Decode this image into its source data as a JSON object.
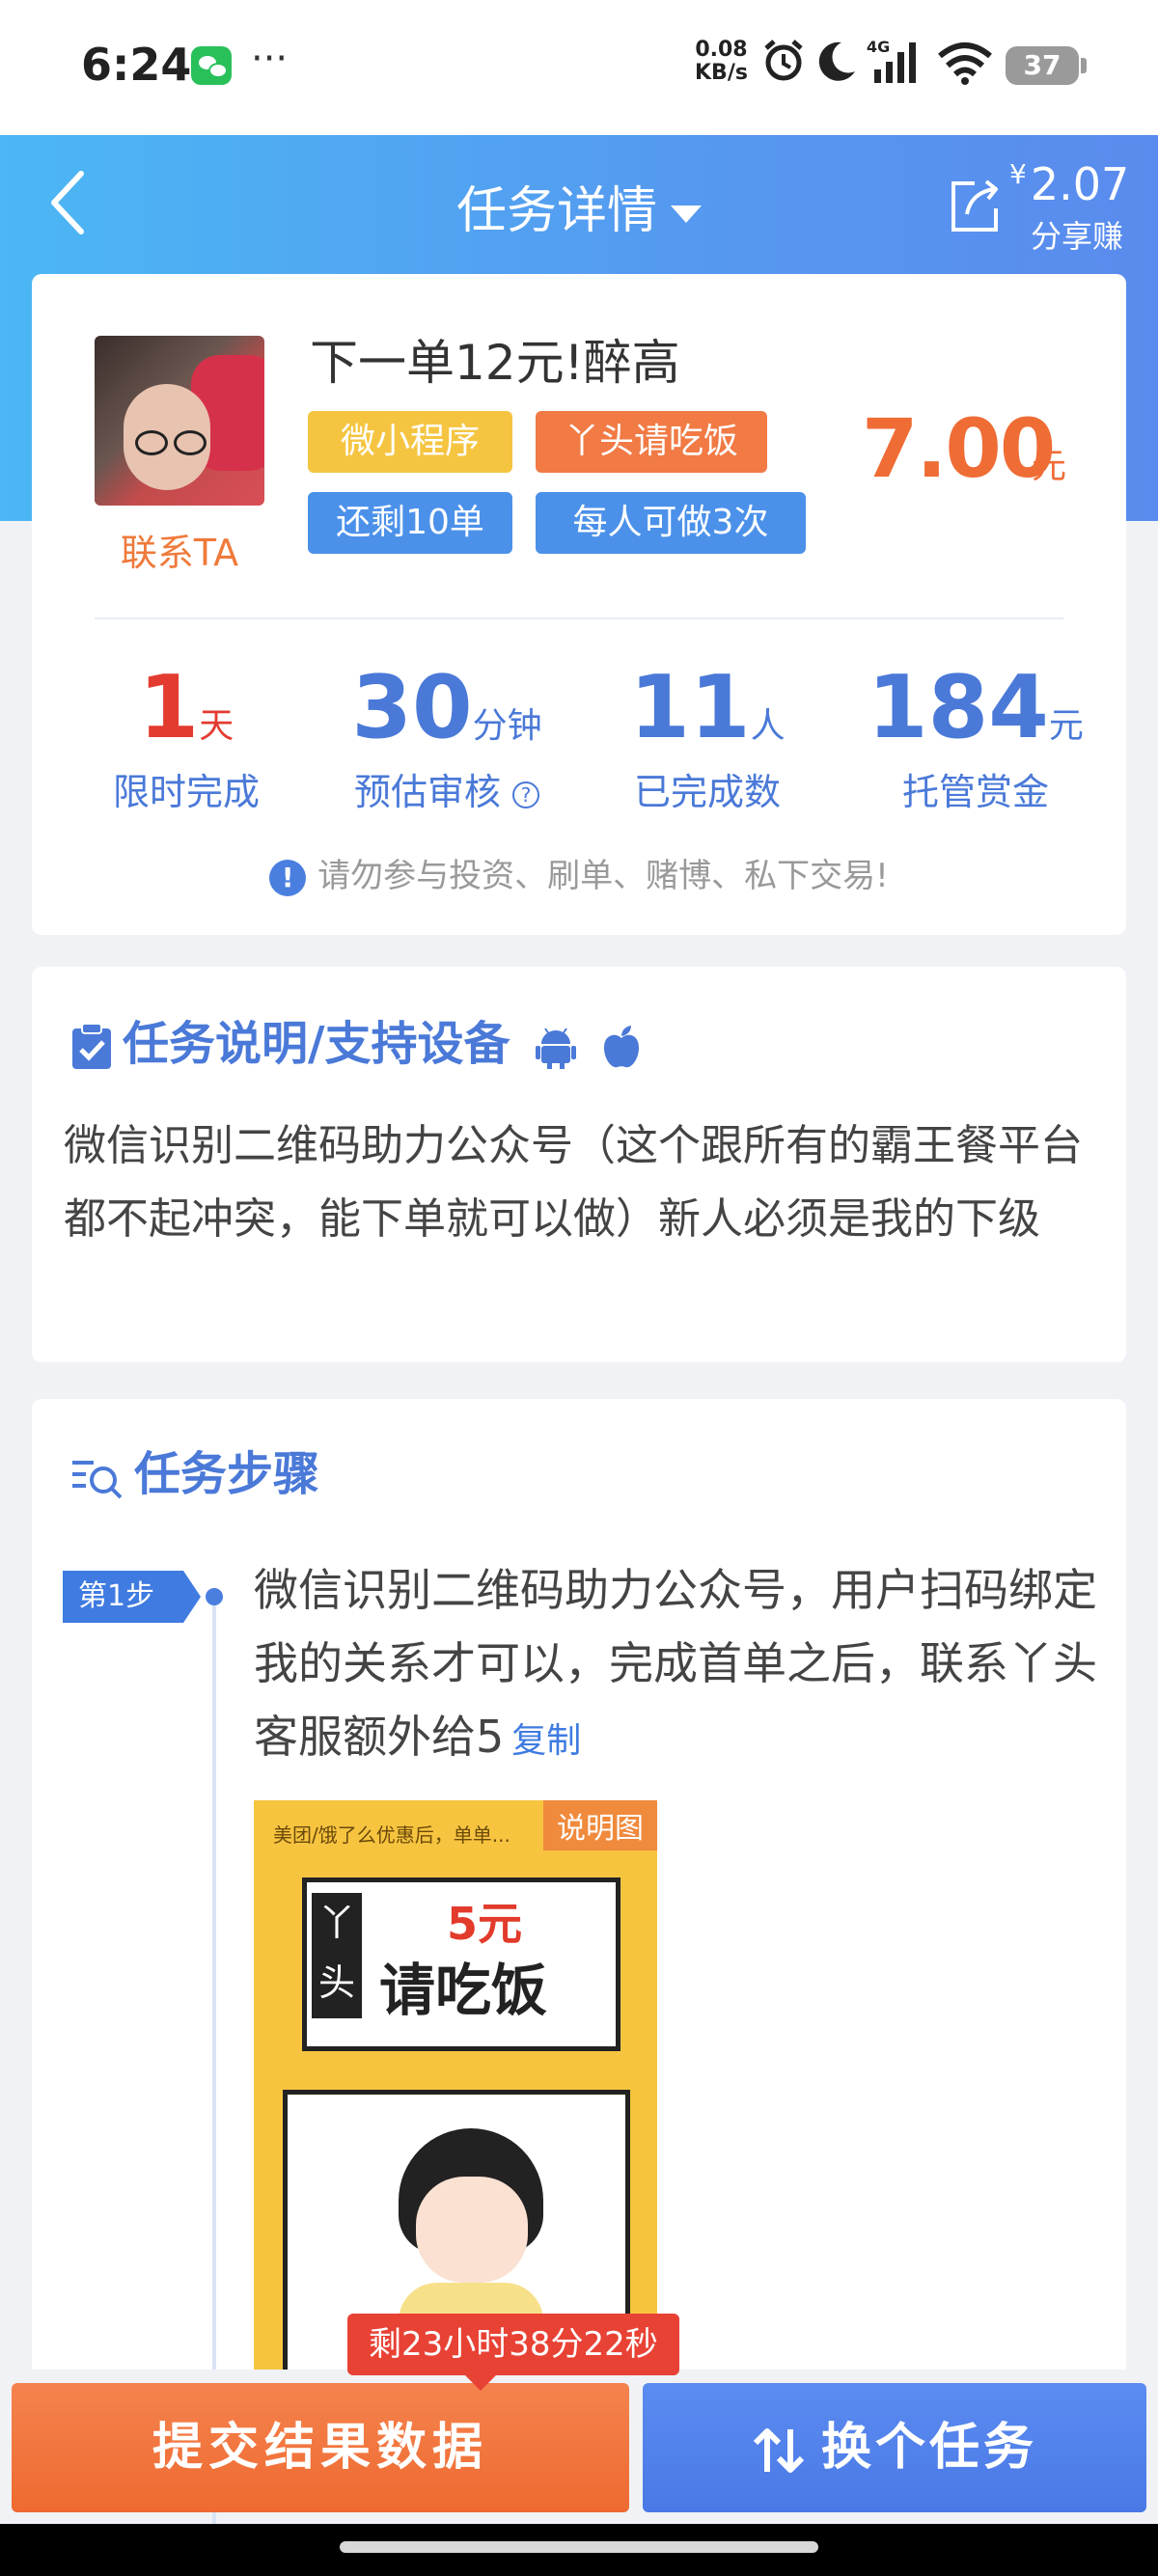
{
  "status_bar": {
    "time": "6:24",
    "more": "···",
    "net_speed_value": "0.08",
    "net_speed_unit": "KB/s",
    "network_type": "4G",
    "battery": "37"
  },
  "header": {
    "title": "任务详情",
    "share_currency": "¥",
    "share_amount": "2.07",
    "share_label": "分享赚",
    "colors": {
      "gradient_start": "#4cb7f4",
      "gradient_end": "#5a8bee"
    }
  },
  "task": {
    "contact_label": "联系TA",
    "title": "下一单12元!醉高",
    "tags": [
      "微小程序",
      "丫头请吃饭",
      "还剩10单",
      "每人可做3次"
    ],
    "price": "7.00",
    "price_unit": "元",
    "stats": [
      {
        "value": "1",
        "unit": "天",
        "label": "限时完成"
      },
      {
        "value": "30",
        "unit": "分钟",
        "label": "预估审核"
      },
      {
        "value": "11",
        "unit": "人",
        "label": "已完成数"
      },
      {
        "value": "184",
        "unit": "元",
        "label": "托管赏金"
      }
    ],
    "warning": "请勿参与投资、刷单、赌博、私下交易!"
  },
  "description": {
    "title": "任务说明/支持设备",
    "text": "微信识别二维码助力公众号（这个跟所有的霸王餐平台都不起冲突，能下单就可以做）新人必须是我的下级"
  },
  "steps": {
    "title": "任务步骤",
    "items": [
      {
        "badge": "第1步",
        "text": "微信识别二维码助力公众号，用户扫码绑定我的关系才可以，完成首单之后，联系丫头客服额外给5",
        "copy_label": "复制",
        "image_tag": "说明图",
        "poster_top": "美团/饿了么优惠后，单单...",
        "poster_logo": "丫头",
        "poster_amount": "5元",
        "poster_main": "请吃饭"
      }
    ]
  },
  "bottom": {
    "countdown": "剩23小时38分22秒",
    "submit_label": "提交结果数据",
    "switch_label": "换个任务"
  }
}
